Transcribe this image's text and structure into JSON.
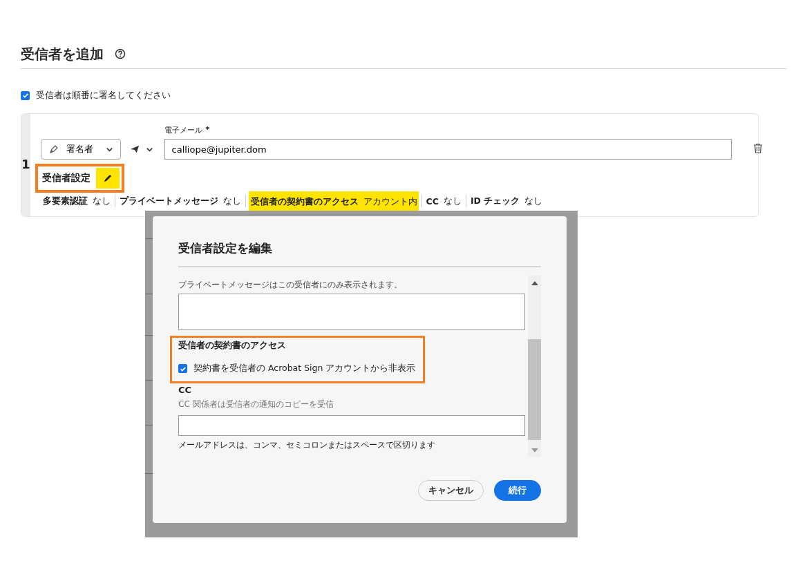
{
  "header": {
    "title": "受信者を追加"
  },
  "sign_in_order": {
    "label": "受信者は順番に署名してください",
    "checked": true
  },
  "recipient": {
    "number": "1",
    "role": "署名者",
    "email_label": "電子メール",
    "required_mark": "*",
    "email": "calliope@jupiter.dom",
    "settings_label": "受信者設定",
    "settings_callout": true,
    "settings": [
      {
        "label": "多要素認証",
        "value": "なし",
        "highlighted": false
      },
      {
        "label": "プライベートメッセージ",
        "value": "なし",
        "highlighted": false
      },
      {
        "label": "受信者の契約書のアクセス",
        "value": "アカウント内",
        "highlighted": true
      },
      {
        "label": "CC",
        "value": "なし",
        "highlighted": false
      },
      {
        "label": "ID チェック",
        "value": "なし",
        "highlighted": false
      }
    ]
  },
  "dialog": {
    "title": "受信者設定を編集",
    "private_message_hint": "プライベートメッセージはこの受信者にのみ表示されます。",
    "access": {
      "heading": "受信者の契約書のアクセス",
      "callout": true,
      "option": {
        "label": "契約書を受信者の Acrobat Sign アカウントから非表示",
        "checked": true
      }
    },
    "cc": {
      "heading": "CC",
      "hint": "CC 関係者は受信者の通知のコピーを受信",
      "note": "メールアドレスは、コンマ、セミコロンまたはスペースで区切ります"
    },
    "buttons": [
      {
        "label": "キャンセル",
        "kind": "secondary"
      },
      {
        "label": "続行",
        "kind": "primary"
      }
    ]
  }
}
